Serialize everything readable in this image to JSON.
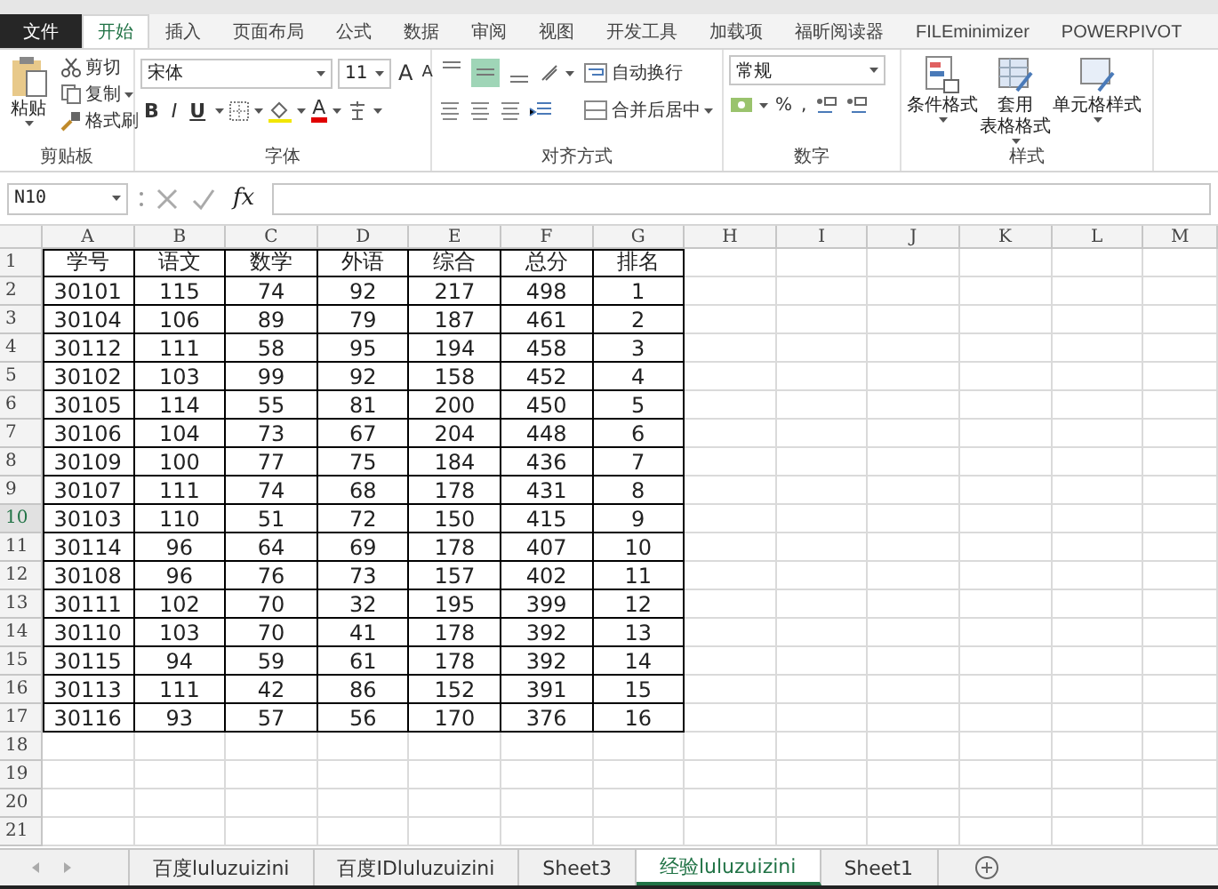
{
  "ribbon_tabs": [
    {
      "label": "文件",
      "kind": "file",
      "selected": false
    },
    {
      "label": "开始",
      "kind": "tab",
      "selected": true
    },
    {
      "label": "插入",
      "kind": "tab",
      "selected": false
    },
    {
      "label": "页面布局",
      "kind": "tab",
      "selected": false
    },
    {
      "label": "公式",
      "kind": "tab",
      "selected": false
    },
    {
      "label": "数据",
      "kind": "tab",
      "selected": false
    },
    {
      "label": "审阅",
      "kind": "tab",
      "selected": false
    },
    {
      "label": "视图",
      "kind": "tab",
      "selected": false
    },
    {
      "label": "开发工具",
      "kind": "tab",
      "selected": false
    },
    {
      "label": "加载项",
      "kind": "tab",
      "selected": false
    },
    {
      "label": "福昕阅读器",
      "kind": "tab",
      "selected": false
    },
    {
      "label": "FILEminimizer",
      "kind": "tab",
      "selected": false
    },
    {
      "label": "POWERPIVOT",
      "kind": "tab",
      "selected": false
    }
  ],
  "ribbon": {
    "groups": [
      {
        "kind": "clipboard",
        "label": "剪贴板",
        "paste": "粘贴",
        "items": [
          "剪切",
          "复制",
          "格式刷"
        ]
      },
      {
        "kind": "font",
        "label": "字体",
        "font": "宋体",
        "size": "11",
        "grow": "A",
        "shrink": "A",
        "styles": [
          "B",
          "I",
          "U"
        ],
        "text_color_letter": "A"
      },
      {
        "kind": "align",
        "label": "对齐方式",
        "valign": [
          {
            "selected": false
          },
          {
            "selected": true
          },
          {
            "selected": false
          }
        ],
        "wrap": "自动换行",
        "merge": "合并后居中"
      },
      {
        "kind": "number",
        "label": "数字",
        "format": "常规",
        "percent": "%",
        "comma": ","
      },
      {
        "kind": "styles",
        "label": "样式",
        "items": [
          [
            "条件格式"
          ],
          [
            "套用",
            "表格格式"
          ],
          [
            "单元格样式"
          ]
        ]
      }
    ]
  },
  "formula_bar": {
    "name_box": "N10",
    "fx": "fx"
  },
  "columns": [
    "A",
    "B",
    "C",
    "D",
    "E",
    "F",
    "G",
    "H",
    "I",
    "J",
    "K",
    "L",
    "M"
  ],
  "rows": [
    {
      "header": "1",
      "selected": false,
      "cells": [
        "学号",
        "语文",
        "数学",
        "外语",
        "综合",
        "总分",
        "排名"
      ]
    },
    {
      "header": "2",
      "selected": false,
      "cells": [
        "30101",
        "115",
        "74",
        "92",
        "217",
        "498",
        "1"
      ]
    },
    {
      "header": "3",
      "selected": false,
      "cells": [
        "30104",
        "106",
        "89",
        "79",
        "187",
        "461",
        "2"
      ]
    },
    {
      "header": "4",
      "selected": false,
      "cells": [
        "30112",
        "111",
        "58",
        "95",
        "194",
        "458",
        "3"
      ]
    },
    {
      "header": "5",
      "selected": false,
      "cells": [
        "30102",
        "103",
        "99",
        "92",
        "158",
        "452",
        "4"
      ]
    },
    {
      "header": "6",
      "selected": false,
      "cells": [
        "30105",
        "114",
        "55",
        "81",
        "200",
        "450",
        "5"
      ]
    },
    {
      "header": "7",
      "selected": false,
      "cells": [
        "30106",
        "104",
        "73",
        "67",
        "204",
        "448",
        "6"
      ]
    },
    {
      "header": "8",
      "selected": false,
      "cells": [
        "30109",
        "100",
        "77",
        "75",
        "184",
        "436",
        "7"
      ]
    },
    {
      "header": "9",
      "selected": false,
      "cells": [
        "30107",
        "111",
        "74",
        "68",
        "178",
        "431",
        "8"
      ]
    },
    {
      "header": "10",
      "selected": true,
      "cells": [
        "30103",
        "110",
        "51",
        "72",
        "150",
        "415",
        "9"
      ]
    },
    {
      "header": "11",
      "selected": false,
      "cells": [
        "30114",
        "96",
        "64",
        "69",
        "178",
        "407",
        "10"
      ]
    },
    {
      "header": "12",
      "selected": false,
      "cells": [
        "30108",
        "96",
        "76",
        "73",
        "157",
        "402",
        "11"
      ]
    },
    {
      "header": "13",
      "selected": false,
      "cells": [
        "30111",
        "102",
        "70",
        "32",
        "195",
        "399",
        "12"
      ]
    },
    {
      "header": "14",
      "selected": false,
      "cells": [
        "30110",
        "103",
        "70",
        "41",
        "178",
        "392",
        "13"
      ]
    },
    {
      "header": "15",
      "selected": false,
      "cells": [
        "30115",
        "94",
        "59",
        "61",
        "178",
        "392",
        "14"
      ]
    },
    {
      "header": "16",
      "selected": false,
      "cells": [
        "30113",
        "111",
        "42",
        "86",
        "152",
        "391",
        "15"
      ]
    },
    {
      "header": "17",
      "selected": false,
      "cells": [
        "30116",
        "93",
        "57",
        "56",
        "170",
        "376",
        "16"
      ]
    },
    {
      "header": "18",
      "selected": false
    },
    {
      "header": "19",
      "selected": false
    },
    {
      "header": "20",
      "selected": false
    },
    {
      "header": "21",
      "selected": false
    }
  ],
  "sheet_tabs": [
    {
      "label": "百度luluzuizini",
      "selected": false
    },
    {
      "label": "百度IDluluzuizini",
      "selected": false
    },
    {
      "label": "Sheet3",
      "selected": false
    },
    {
      "label": "经验luluzuizini",
      "selected": true
    },
    {
      "label": "Sheet1",
      "selected": false
    }
  ]
}
